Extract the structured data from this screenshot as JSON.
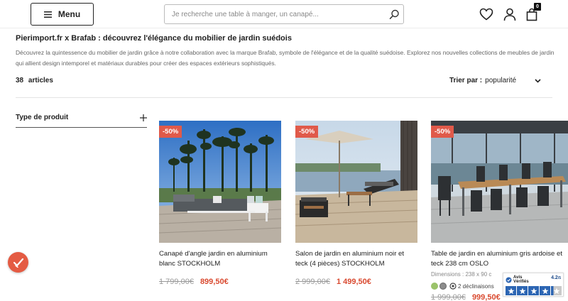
{
  "header": {
    "menu_label": "Menu",
    "search_placeholder": "Je recherche une table à manger, un canapé...",
    "cart_count": "0",
    "icons": [
      "menu-icon",
      "search-icon",
      "heart-icon",
      "user-icon",
      "bag-icon"
    ]
  },
  "page": {
    "title": "Pierimport.fr x Brafab : découvrez l'élégance du mobilier de jardin suédois",
    "intro": "Découvrez la quintessence du mobilier de jardin grâce à notre collaboration avec la marque Brafab, symbole de l'élégance et de la qualité suédoise. Explorez nos nouvelles collections de meubles de jardin qui allient design intemporel et matériaux durables pour créer des espaces extérieurs sophistiqués.",
    "article_count": "38",
    "article_label": "articles",
    "sort_label": "Trier par :",
    "sort_value": "popularité"
  },
  "filters": [
    {
      "label": "Type de produit",
      "icon": "plus-icon"
    }
  ],
  "products": [
    {
      "badge": "-50%",
      "name": "Canapé d'angle jardin en aluminium blanc STOCKHOLM",
      "old_price": "1 799,00€",
      "new_price": "899,50€"
    },
    {
      "badge": "-50%",
      "name": "Salon de jardin en aluminium noir et teck (4 pièces) STOCKHOLM",
      "old_price": "2 999,00€",
      "new_price": "1 499,50€"
    },
    {
      "badge": "-50%",
      "name": "Table de jardin en aluminium gris ardoise et teck 238 cm OSLO",
      "dimensions": "Dimensions : 238 x 90 c",
      "swatch_colors": [
        "#9bc36a",
        "#8c8c8c"
      ],
      "variants": "2 déclinaisons",
      "old_price": "1 999,00€",
      "new_price": "999,50€"
    }
  ],
  "reviews_widget": {
    "brand": [
      "Avis",
      "Vérifiés"
    ],
    "score": "4.2",
    "score_suffix": "/5",
    "star_color": "#2c65b3"
  },
  "colors": {
    "accent": "#e05a4a",
    "price": "#d9492f"
  }
}
